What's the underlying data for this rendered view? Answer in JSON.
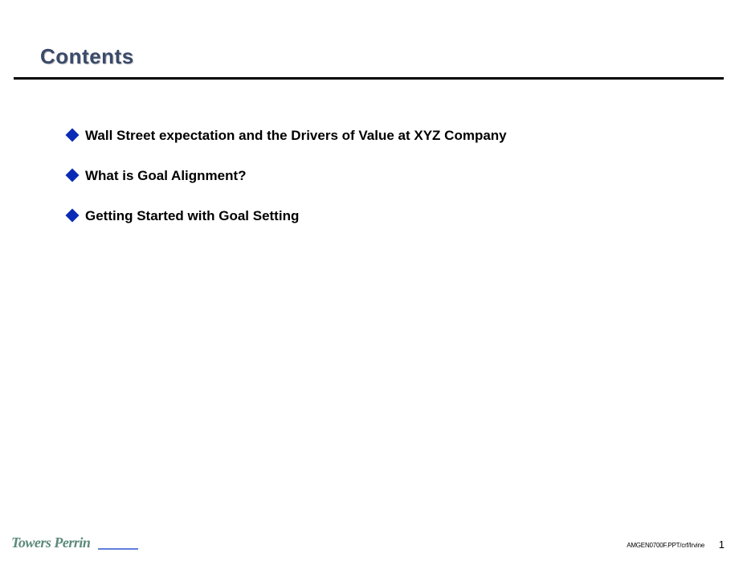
{
  "slide": {
    "title": "Contents",
    "items": [
      "Wall Street expectation and the Drivers of Value at  XYZ Company",
      "What is Goal Alignment?",
      "Getting Started with Goal Setting"
    ]
  },
  "footer": {
    "brand": "Towers Perrin",
    "doc_id": "AMGEN0700F.PPT/crf/Irvine",
    "page_number": "1"
  }
}
